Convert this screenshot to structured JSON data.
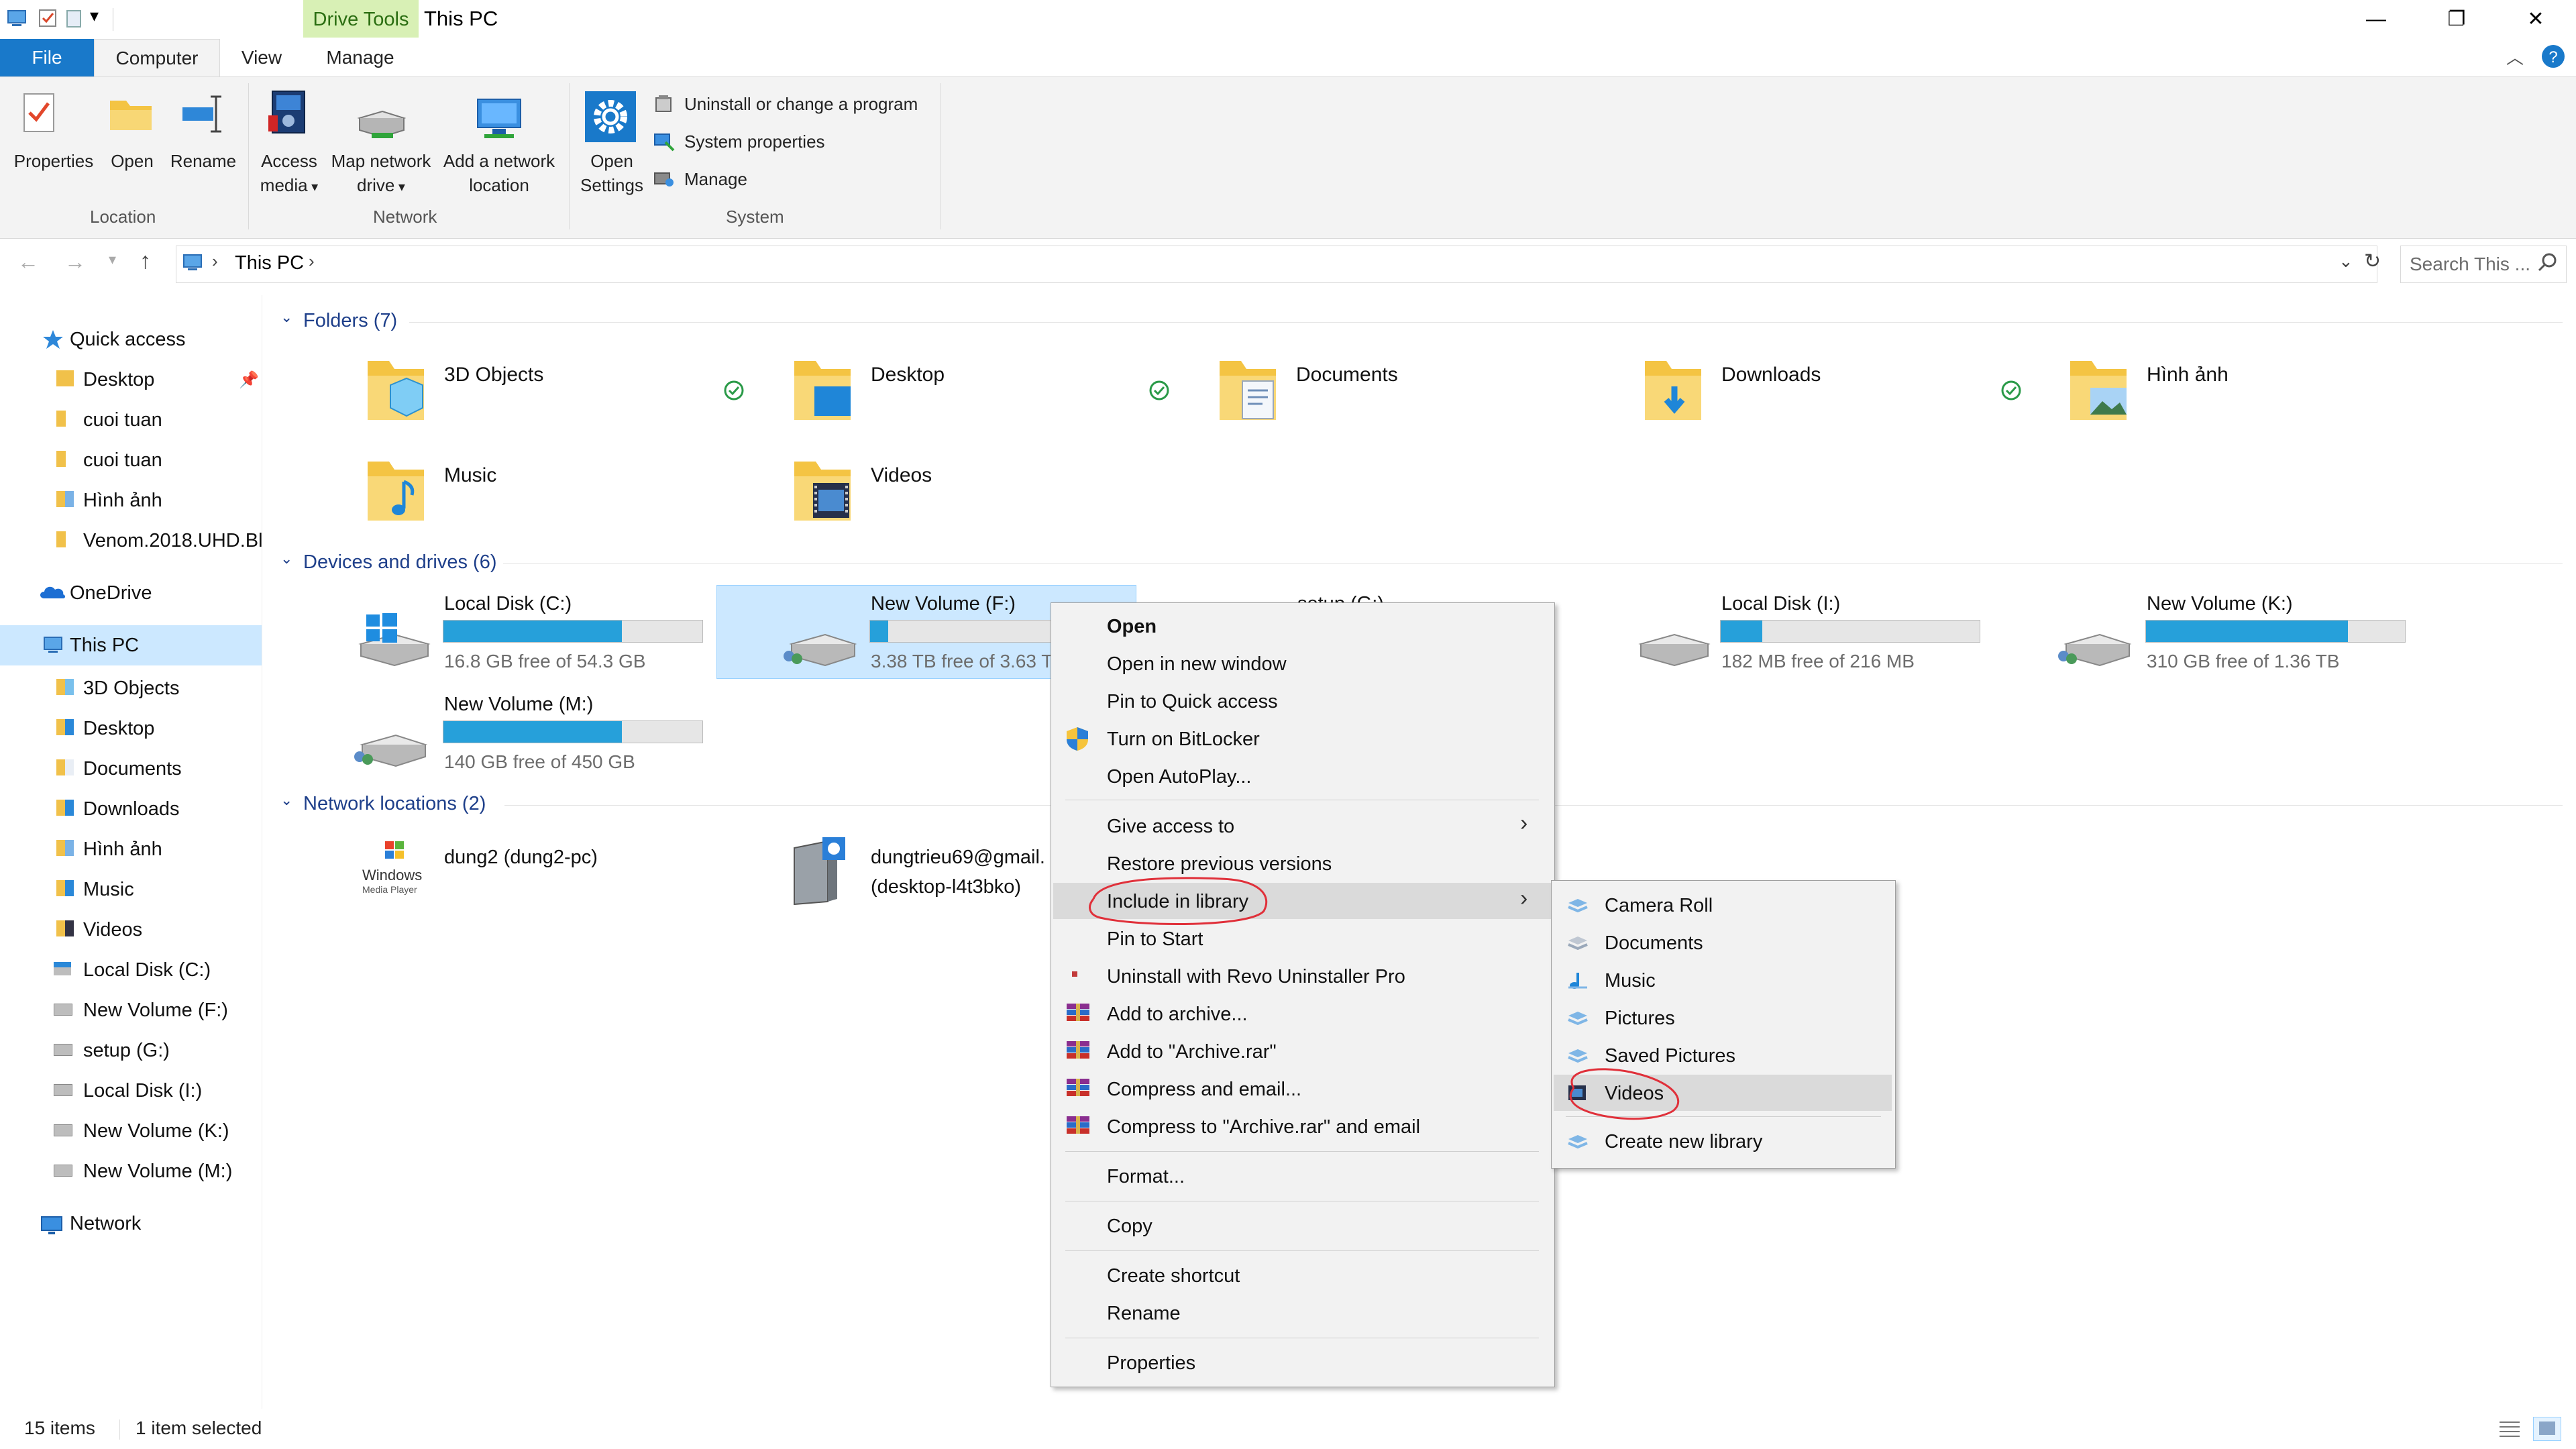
{
  "window": {
    "title": "This PC",
    "contextual_tab": "Drive Tools",
    "minimize": "—",
    "maximize": "❐",
    "close": "✕"
  },
  "ribbon": {
    "tabs": [
      "File",
      "Computer",
      "View",
      "Manage"
    ],
    "active_tab": "Computer",
    "location_group": "Location",
    "network_group": "Network",
    "system_group": "System",
    "properties": "Properties",
    "open": "Open",
    "rename": "Rename",
    "access_media_1": "Access",
    "access_media_2": "media",
    "map_drive_1": "Map network",
    "map_drive_2": "drive",
    "add_location_1": "Add a network",
    "add_location_2": "location",
    "open_settings_1": "Open",
    "open_settings_2": "Settings",
    "uninstall": "Uninstall or change a program",
    "system_properties": "System properties",
    "manage": "Manage"
  },
  "address": {
    "path": "This PC",
    "search_placeholder": "Search This ..."
  },
  "nav": {
    "quick_access": "Quick access",
    "quick_items": [
      "Desktop",
      "cuoi tuan",
      "cuoi tuan",
      "Hình ảnh",
      "Venom.2018.UHD.Bl"
    ],
    "onedrive": "OneDrive",
    "this_pc": "This PC",
    "pc_items": [
      "3D Objects",
      "Desktop",
      "Documents",
      "Downloads",
      "Hình ảnh",
      "Music",
      "Videos",
      "Local Disk (C:)",
      "New Volume (F:)",
      "setup (G:)",
      "Local Disk (I:)",
      "New Volume (K:)",
      "New Volume (M:)"
    ],
    "network": "Network"
  },
  "content": {
    "folders_header": "Folders (7)",
    "folders": [
      "3D Objects",
      "Desktop",
      "Documents",
      "Downloads",
      "Hình ảnh",
      "Music",
      "Videos"
    ],
    "devices_header": "Devices and drives (6)",
    "drives": [
      {
        "name": "Local Disk (C:)",
        "free": "16.8 GB free of 54.3 GB",
        "used_fraction": 0.69
      },
      {
        "name": "New Volume (F:)",
        "free": "3.38 TB free of 3.63 T",
        "used_fraction": 0.07
      },
      {
        "name": "setup (G:)",
        "free": "",
        "used_fraction": 0
      },
      {
        "name": "Local Disk (I:)",
        "free": "182 MB free of 216 MB",
        "used_fraction": 0.16
      },
      {
        "name": "New Volume (K:)",
        "free": "310 GB free of 1.36 TB",
        "used_fraction": 0.78
      },
      {
        "name": "New Volume (M:)",
        "free": "140 GB free of 450 GB",
        "used_fraction": 0.69
      }
    ],
    "network_header": "Network locations (2)",
    "network_items": [
      {
        "name": "dung2 (dung2-pc)",
        "line2": ""
      },
      {
        "name": "dungtrieu69@gmail.",
        "line2": "(desktop-l4t3bko)"
      }
    ],
    "wmp_label_1": "Windows",
    "wmp_label_2": "Media Player"
  },
  "context_menu": {
    "items": [
      "Open",
      "Open in new window",
      "Pin to Quick access",
      "Turn on BitLocker",
      "Open AutoPlay...",
      "Give access to",
      "Restore previous versions",
      "Include in library",
      "Pin to Start",
      "Uninstall with Revo Uninstaller Pro",
      "Add to archive...",
      "Add to \"Archive.rar\"",
      "Compress and email...",
      "Compress to \"Archive.rar\" and email",
      "Format...",
      "Copy",
      "Create shortcut",
      "Rename",
      "Properties"
    ],
    "highlighted": "Include in library"
  },
  "submenu": {
    "items": [
      "Camera Roll",
      "Documents",
      "Music",
      "Pictures",
      "Saved Pictures",
      "Videos",
      "Create new library"
    ],
    "highlighted": "Videos"
  },
  "status": {
    "count": "15 items",
    "selected": "1 item selected"
  },
  "colors": {
    "accent": "#1979ca",
    "selection": "#cce8ff",
    "drive_bar": "#26a0da",
    "annotation": "#e0303a"
  }
}
